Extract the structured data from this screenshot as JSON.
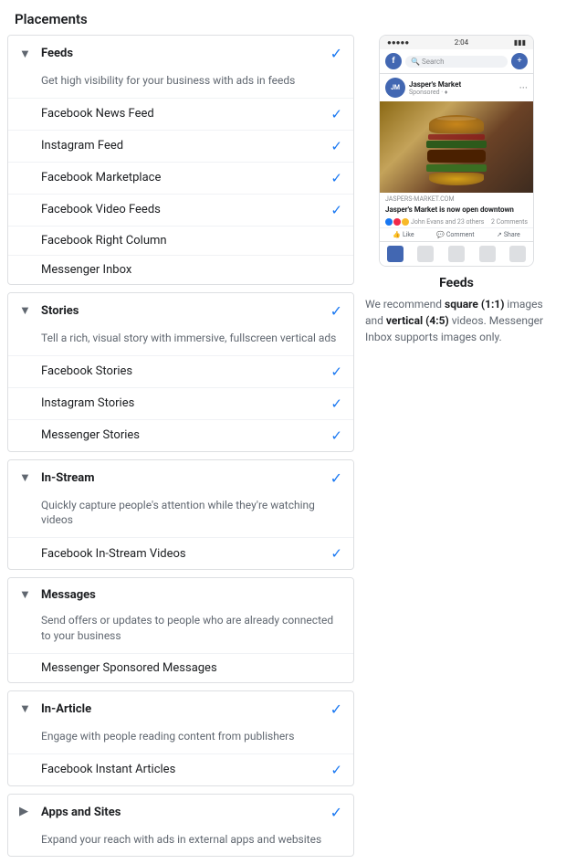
{
  "page": {
    "title": "Placements"
  },
  "sections": [
    {
      "id": "feeds",
      "title": "Feeds",
      "description": "Get high visibility for your business with ads in feeds",
      "expanded": true,
      "checked": true,
      "chevron": "▼",
      "items": [
        {
          "label": "Facebook News Feed",
          "checked": true
        },
        {
          "label": "Instagram Feed",
          "checked": true
        },
        {
          "label": "Facebook Marketplace",
          "checked": true
        },
        {
          "label": "Facebook Video Feeds",
          "checked": true
        },
        {
          "label": "Facebook Right Column",
          "checked": false
        },
        {
          "label": "Messenger Inbox",
          "checked": false
        }
      ]
    },
    {
      "id": "stories",
      "title": "Stories",
      "description": "Tell a rich, visual story with immersive, fullscreen vertical ads",
      "expanded": true,
      "checked": true,
      "chevron": "▼",
      "items": [
        {
          "label": "Facebook Stories",
          "checked": true
        },
        {
          "label": "Instagram Stories",
          "checked": true
        },
        {
          "label": "Messenger Stories",
          "checked": true
        }
      ]
    },
    {
      "id": "instream",
      "title": "In-Stream",
      "description": "Quickly capture people's attention while they're watching videos",
      "expanded": true,
      "checked": true,
      "chevron": "▼",
      "items": [
        {
          "label": "Facebook In-Stream Videos",
          "checked": true
        }
      ]
    },
    {
      "id": "messages",
      "title": "Messages",
      "description": "Send offers or updates to people who are already connected to your business",
      "expanded": true,
      "checked": false,
      "chevron": "▼",
      "items": [
        {
          "label": "Messenger Sponsored Messages",
          "checked": false
        }
      ]
    },
    {
      "id": "inarticle",
      "title": "In-Article",
      "description": "Engage with people reading content from publishers",
      "expanded": true,
      "checked": true,
      "chevron": "▼",
      "items": [
        {
          "label": "Facebook Instant Articles",
          "checked": true
        }
      ]
    },
    {
      "id": "appsites",
      "title": "Apps and Sites",
      "description": "Expand your reach with ads in external apps and websites",
      "expanded": false,
      "checked": true,
      "chevron": "▶",
      "items": []
    }
  ],
  "preview": {
    "title": "Feeds",
    "description": "We recommend",
    "desc_square": "square (1:1)",
    "desc_middle": "images and",
    "desc_vertical": "vertical (4:5)",
    "desc_end": "videos. Messenger Inbox supports images only.",
    "phone": {
      "time": "2:04",
      "poster": "Jasper's Market",
      "sponsored_label": "Sponsored · ♦",
      "link_domain": "JASPERS-MARKET.COM",
      "link_title": "Jasper's Market is now open downtown",
      "reactions_text": "John Evans and 23 others",
      "comments_text": "2 Comments",
      "action_like": "Like",
      "action_comment": "Comment",
      "action_share": "Share"
    }
  }
}
